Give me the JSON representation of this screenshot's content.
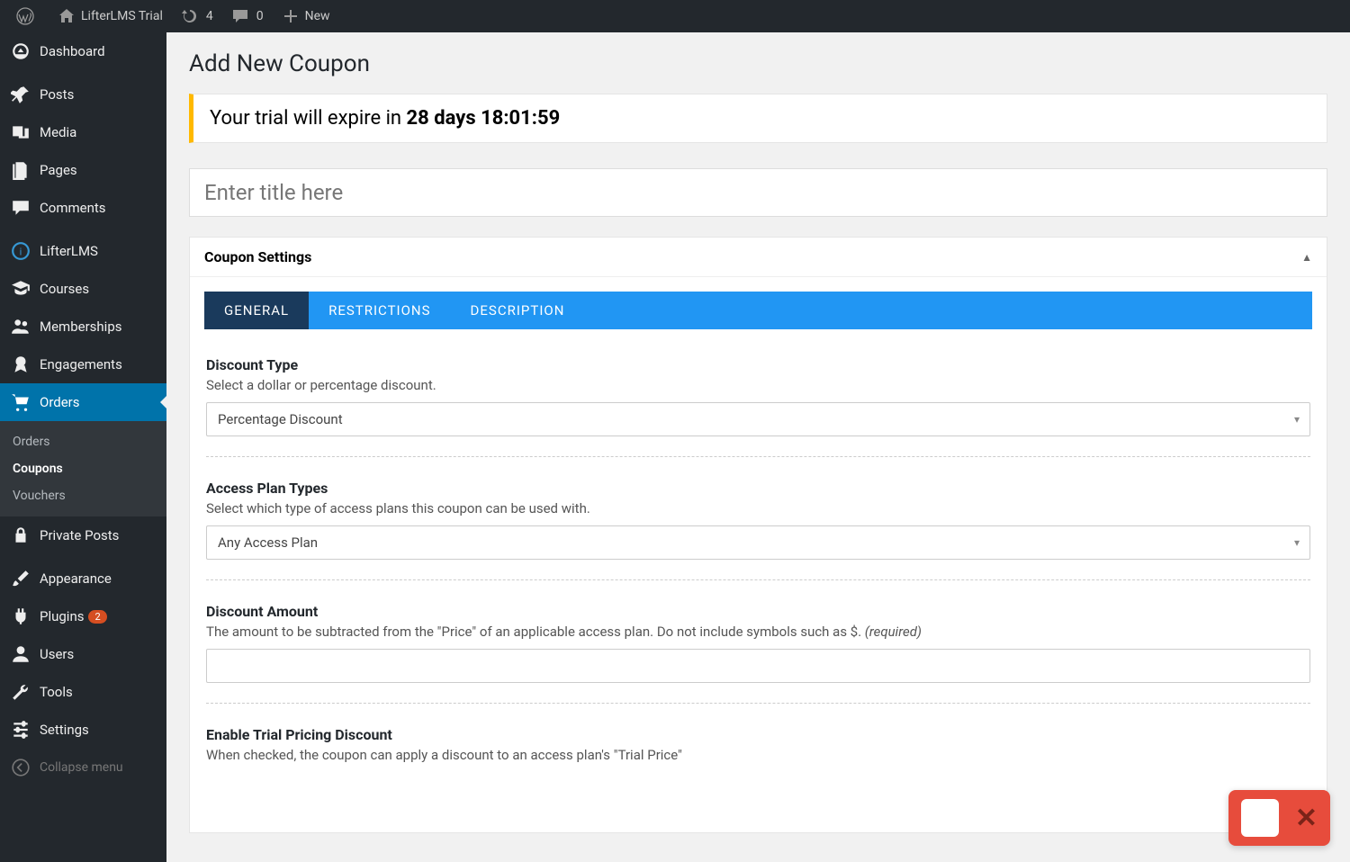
{
  "adminbar": {
    "site_name": "LifterLMS Trial",
    "updates": "4",
    "comments": "0",
    "new": "New"
  },
  "sidebar": {
    "dashboard": "Dashboard",
    "posts": "Posts",
    "media": "Media",
    "pages": "Pages",
    "comments": "Comments",
    "lifterlms": "LifterLMS",
    "courses": "Courses",
    "memberships": "Memberships",
    "engagements": "Engagements",
    "orders": "Orders",
    "sub_orders": "Orders",
    "sub_coupons": "Coupons",
    "sub_vouchers": "Vouchers",
    "private_posts": "Private Posts",
    "appearance": "Appearance",
    "plugins": "Plugins",
    "plugins_badge": "2",
    "users": "Users",
    "tools": "Tools",
    "settings": "Settings",
    "collapse": "Collapse menu"
  },
  "page": {
    "title": "Add New Coupon",
    "trial_prefix": "Your trial will expire in ",
    "trial_time": "28 days 18:01:59",
    "title_placeholder": "Enter title here"
  },
  "box": {
    "heading": "Coupon Settings",
    "tabs": {
      "general": "GENERAL",
      "restrictions": "RESTRICTIONS",
      "description": "DESCRIPTION"
    }
  },
  "fields": {
    "discount_type": {
      "label": "Discount Type",
      "desc": "Select a dollar or percentage discount.",
      "value": "Percentage Discount"
    },
    "access_plan": {
      "label": "Access Plan Types",
      "desc": "Select which type of access plans this coupon can be used with.",
      "value": "Any Access Plan"
    },
    "discount_amount": {
      "label": "Discount Amount",
      "desc_pre": "The amount to be subtracted from the \"Price\" of an applicable access plan. Do not include symbols such as $. ",
      "desc_req": "(required)"
    },
    "trial_discount": {
      "label": "Enable Trial Pricing Discount",
      "desc": "When checked, the coupon can apply a discount to an access plan's \"Trial Price\""
    }
  }
}
